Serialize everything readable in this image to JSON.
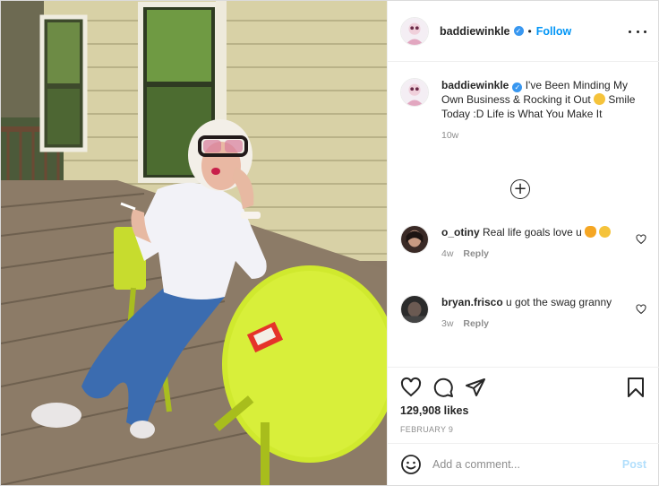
{
  "header": {
    "username": "baddiewinkle",
    "separator": "•",
    "follow_label": "Follow",
    "more_icon": "more-horizontal-icon"
  },
  "caption": {
    "username": "baddiewinkle",
    "text_part1": "I've Been Minding My Own Business & Rocking it Out",
    "emoji": "yum-face-emoji",
    "text_part2": "Smile Today :D Life is What You Make It",
    "time": "10w"
  },
  "load_more_label": "+",
  "comments": [
    {
      "username": "o_otiny",
      "text": "Real life goals love u",
      "emojis": [
        "fire-emoji",
        "heart-eyes-emoji"
      ],
      "time": "4w",
      "reply_label": "Reply"
    },
    {
      "username": "bryan.frisco",
      "text": "u got the swag granny",
      "time": "3w",
      "reply_label": "Reply"
    }
  ],
  "actions": {
    "icons": [
      "heart-icon",
      "comment-icon",
      "share-icon",
      "save-icon"
    ],
    "likes": "129,908 likes",
    "date": "FEBRUARY 9"
  },
  "add_comment": {
    "placeholder": "Add a comment...",
    "post_label": "Post"
  },
  "colors": {
    "link_blue": "#0095f6",
    "post_disabled": "#b2dffc",
    "meta_gray": "#8e8e8e",
    "text": "#262626",
    "verified": "#3897f0"
  }
}
